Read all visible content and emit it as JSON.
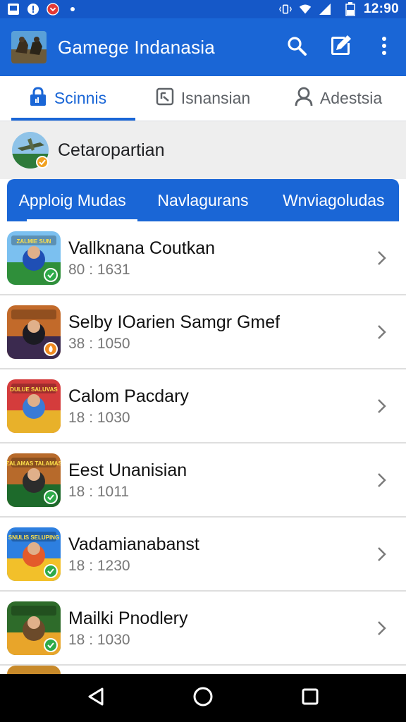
{
  "status_bar": {
    "time": "12:90",
    "left_icons": [
      "photo-icon",
      "alert-icon",
      "notification-app-icon",
      "dot-icon"
    ],
    "right_icons": [
      "vibrate-icon",
      "wifi-icon",
      "signal-icon",
      "battery-icon"
    ]
  },
  "app_bar": {
    "title": "Gamege Indanasia",
    "actions": [
      "search-icon",
      "compose-icon",
      "more-vert-icon"
    ]
  },
  "top_tabs": [
    {
      "label": "Scinnis",
      "icon": "lock-icon",
      "active": true
    },
    {
      "label": "Isnansian",
      "icon": "square-icon",
      "active": false
    },
    {
      "label": "Adestsia",
      "icon": "person-icon",
      "active": false
    }
  ],
  "section": {
    "title": "Cetaropartian"
  },
  "sub_tabs": [
    {
      "label": "Apploig Mudas",
      "active": true
    },
    {
      "label": "Navlagurans",
      "active": false
    },
    {
      "label": "Wnviagoludas",
      "active": false
    }
  ],
  "items": [
    {
      "title": "Vallknanа Coutkan",
      "sub": "80 : 1631",
      "thumb_label": "ZALMIE SUN",
      "badge": "check",
      "c1": "#2f8f3a",
      "c2": "#7bc0f0",
      "c3": "#1f4fb5"
    },
    {
      "title": "Selby IOarien Samgr Gmef",
      "sub": "38 : 1050",
      "thumb_label": "",
      "badge": "fire",
      "c1": "#3b2a4f",
      "c2": "#c26a2a",
      "c3": "#1b1b22"
    },
    {
      "title": "Calom Pacdary",
      "sub": "18 : 1030",
      "thumb_label": "DULUE SALUVAS",
      "badge": "none",
      "c1": "#e8b12a",
      "c2": "#d43c3c",
      "c3": "#3a7bd5"
    },
    {
      "title": "Eest Unanisian",
      "sub": "18 : 1011",
      "thumb_label": "ZALAMAS TALAMAS",
      "badge": "check",
      "c1": "#1d6a2b",
      "c2": "#b76a2b",
      "c3": "#2c2c2c"
    },
    {
      "title": "Vadamianabanst",
      "sub": "18 : 1230",
      "thumb_label": "SNULIS SELUPING",
      "badge": "check",
      "c1": "#f2c02a",
      "c2": "#2d7fe0",
      "c3": "#e35b2b"
    },
    {
      "title": "Mailki Pnodlery",
      "sub": "18 : 1030",
      "thumb_label": "",
      "badge": "check",
      "c1": "#e8a52a",
      "c2": "#2e6b2a",
      "c3": "#6b4a2a"
    }
  ],
  "nav_bar": [
    "back-icon",
    "home-icon",
    "recents-icon"
  ]
}
